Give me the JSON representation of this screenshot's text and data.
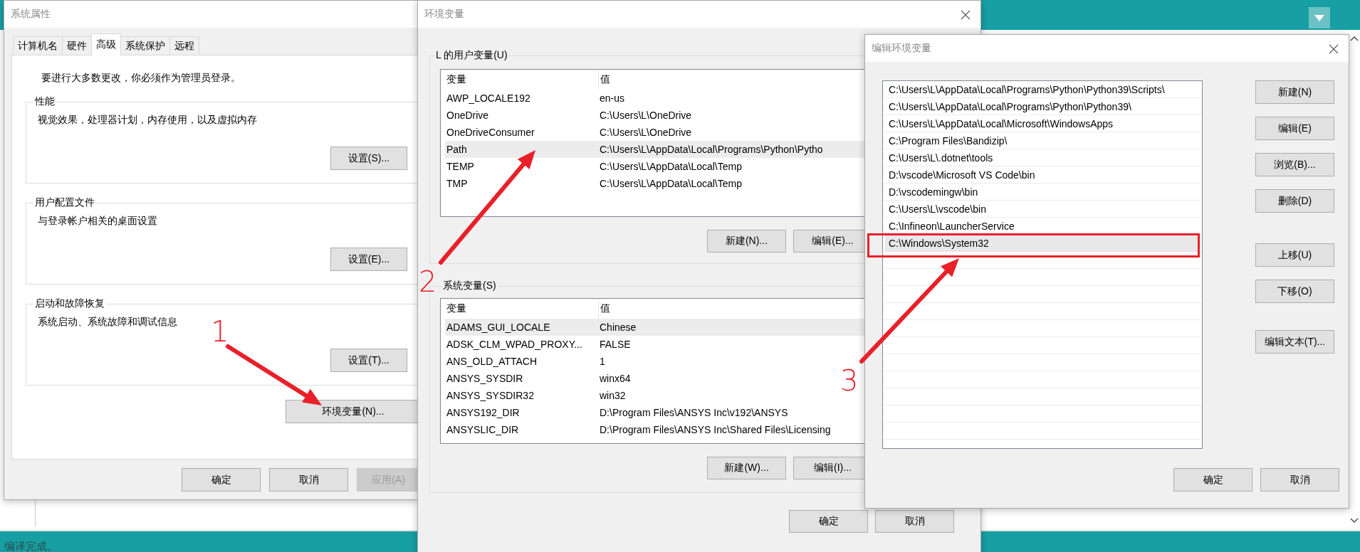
{
  "background_app": {
    "status_text": "编译完成。"
  },
  "system_properties": {
    "title": "系统属性",
    "tabs": [
      {
        "label": "计算机名",
        "selected": false
      },
      {
        "label": "硬件",
        "selected": false
      },
      {
        "label": "高级",
        "selected": true
      },
      {
        "label": "系统保护",
        "selected": false
      },
      {
        "label": "远程",
        "selected": false
      }
    ],
    "admin_note": "要进行大多数更改，你必须作为管理员登录。",
    "groups": [
      {
        "title": "性能",
        "description": "视觉效果，处理器计划，内存使用，以及虚拟内存",
        "button": "设置(S)..."
      },
      {
        "title": "用户配置文件",
        "description": "与登录帐户相关的桌面设置",
        "button": "设置(E)..."
      },
      {
        "title": "启动和故障恢复",
        "description": "系统启动、系统故障和调试信息",
        "button": "设置(T)..."
      }
    ],
    "env_button": "环境变量(N)...",
    "buttons": [
      {
        "label": "确定",
        "disabled": false
      },
      {
        "label": "取消",
        "disabled": false
      },
      {
        "label": "应用(A)",
        "disabled": true
      }
    ]
  },
  "environment_variables": {
    "title": "环境变量",
    "user_vars": {
      "title": "L 的用户变量(U)",
      "columns": [
        "变量",
        "值"
      ],
      "rows": [
        {
          "name": "AWP_LOCALE192",
          "value": "en-us",
          "selected": false
        },
        {
          "name": "OneDrive",
          "value": "C:\\Users\\L\\OneDrive",
          "selected": false
        },
        {
          "name": "OneDriveConsumer",
          "value": "C:\\Users\\L\\OneDrive",
          "selected": false
        },
        {
          "name": "Path",
          "value": "C:\\Users\\L\\AppData\\Local\\Programs\\Python\\Pytho",
          "selected": true
        },
        {
          "name": "TEMP",
          "value": "C:\\Users\\L\\AppData\\Local\\Temp",
          "selected": false
        },
        {
          "name": "TMP",
          "value": "C:\\Users\\L\\AppData\\Local\\Temp",
          "selected": false
        }
      ],
      "buttons": [
        "新建(N)...",
        "编辑(E)..."
      ]
    },
    "system_vars": {
      "title": "系统变量(S)",
      "columns": [
        "变量",
        "值"
      ],
      "rows": [
        {
          "name": "ADAMS_GUI_LOCALE",
          "value": "Chinese",
          "selected": true
        },
        {
          "name": "ADSK_CLM_WPAD_PROXY...",
          "value": "FALSE",
          "selected": false
        },
        {
          "name": "ANS_OLD_ATTACH",
          "value": "1",
          "selected": false
        },
        {
          "name": "ANSYS_SYSDIR",
          "value": "winx64",
          "selected": false
        },
        {
          "name": "ANSYS_SYSDIR32",
          "value": "win32",
          "selected": false
        },
        {
          "name": "ANSYS192_DIR",
          "value": "D:\\Program Files\\ANSYS Inc\\v192\\ANSYS",
          "selected": false
        },
        {
          "name": "ANSYSLIC_DIR",
          "value": "D:\\Program Files\\ANSYS Inc\\Shared Files\\Licensing",
          "selected": false
        }
      ],
      "buttons": [
        "新建(W)...",
        "编辑(I)..."
      ]
    },
    "buttons": [
      "确定",
      "取消"
    ]
  },
  "edit_env_var": {
    "title": "编辑环境变量",
    "entries": [
      {
        "text": "C:\\Users\\L\\AppData\\Local\\Programs\\Python\\Python39\\Scripts\\",
        "selected": false,
        "boxed": false
      },
      {
        "text": "C:\\Users\\L\\AppData\\Local\\Programs\\Python\\Python39\\",
        "selected": false,
        "boxed": false
      },
      {
        "text": "C:\\Users\\L\\AppData\\Local\\Microsoft\\WindowsApps",
        "selected": false,
        "boxed": false
      },
      {
        "text": "C:\\Program Files\\Bandizip\\",
        "selected": false,
        "boxed": false
      },
      {
        "text": "C:\\Users\\L\\.dotnet\\tools",
        "selected": false,
        "boxed": false
      },
      {
        "text": "D:\\vscode\\Microsoft VS Code\\bin",
        "selected": false,
        "boxed": false
      },
      {
        "text": "D:\\vscodemingw\\bin",
        "selected": false,
        "boxed": false
      },
      {
        "text": "C:\\Users\\L\\vscode\\bin",
        "selected": false,
        "boxed": false
      },
      {
        "text": "C:\\Infineon\\LauncherService",
        "selected": false,
        "boxed": false
      },
      {
        "text": "C:\\Windows\\System32",
        "selected": true,
        "boxed": true
      }
    ],
    "button_groups": [
      [
        "新建(N)",
        "编辑(E)",
        "浏览(B)...",
        "删除(D)"
      ],
      [
        "上移(U)",
        "下移(O)"
      ],
      [
        "编辑文本(T)..."
      ]
    ],
    "buttons": [
      "确定",
      "取消"
    ]
  },
  "annotations": [
    {
      "label": "1"
    },
    {
      "label": "2"
    },
    {
      "label": "3"
    }
  ]
}
